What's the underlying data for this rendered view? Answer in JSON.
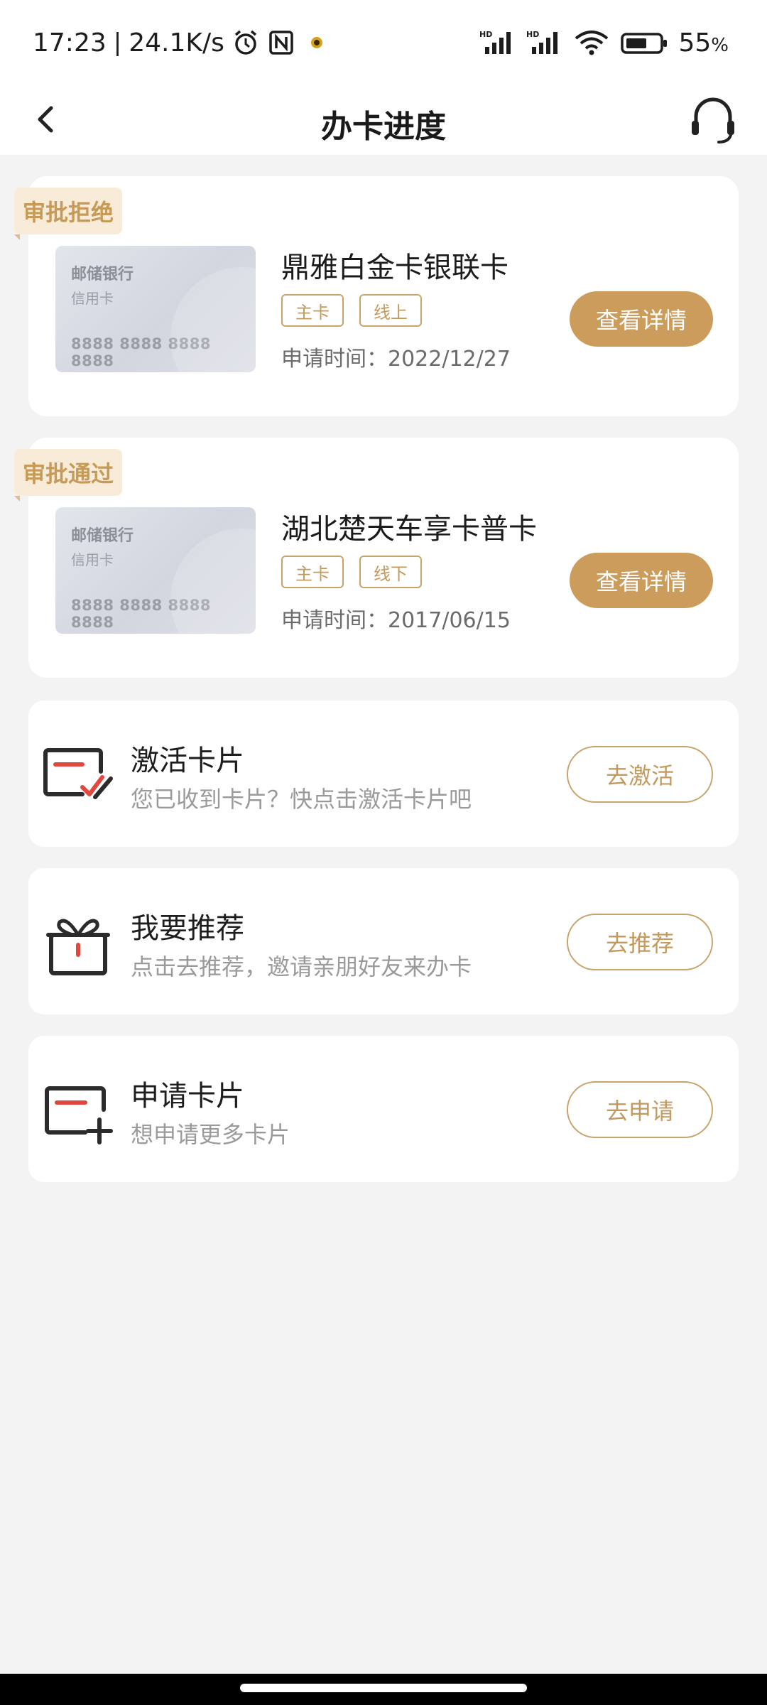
{
  "status_bar": {
    "time": "17:23",
    "speed": "24.1K/s",
    "battery": "55",
    "battery_unit": "%",
    "icons": [
      "alarm-icon",
      "nfc-icon",
      "app-notification-icon",
      "signal-hd-icon",
      "wifi-icon",
      "battery-icon"
    ]
  },
  "header": {
    "title": "办卡进度",
    "back_icon": "chevron-left-icon",
    "service_icon": "headset-icon"
  },
  "applications": [
    {
      "status": "审批拒绝",
      "card_image": {
        "bank": "邮储银行",
        "type": "信用卡",
        "number": "8888 8888 8888 8888"
      },
      "name": "鼎雅白金卡银联卡",
      "tags": [
        "主卡",
        "线上"
      ],
      "apply_time": "申请时间：2022/12/27",
      "button": "查看详情"
    },
    {
      "status": "审批通过",
      "card_image": {
        "bank": "邮储银行",
        "type": "信用卡",
        "number": "8888 8888 8888 8888"
      },
      "name": "湖北楚天车享卡普卡",
      "tags": [
        "主卡",
        "线下"
      ],
      "apply_time": "申请时间：2017/06/15",
      "button": "查看详情"
    }
  ],
  "actions": [
    {
      "icon": "card-check-icon",
      "title": "激活卡片",
      "subtitle": "您已收到卡片？快点击激活卡片吧",
      "button": "去激活"
    },
    {
      "icon": "gift-icon",
      "title": "我要推荐",
      "subtitle": "点击去推荐，邀请亲朋好友来办卡",
      "button": "去推荐"
    },
    {
      "icon": "card-add-icon",
      "title": "申请卡片",
      "subtitle": "想申请更多卡片",
      "button": "去申请"
    }
  ],
  "colors": {
    "accent": "#cb9c5c",
    "status_tag_bg": "#f8ecd9",
    "status_tag_text": "#c89a57",
    "icon_red": "#e0473f",
    "background": "#f3f3f4"
  }
}
